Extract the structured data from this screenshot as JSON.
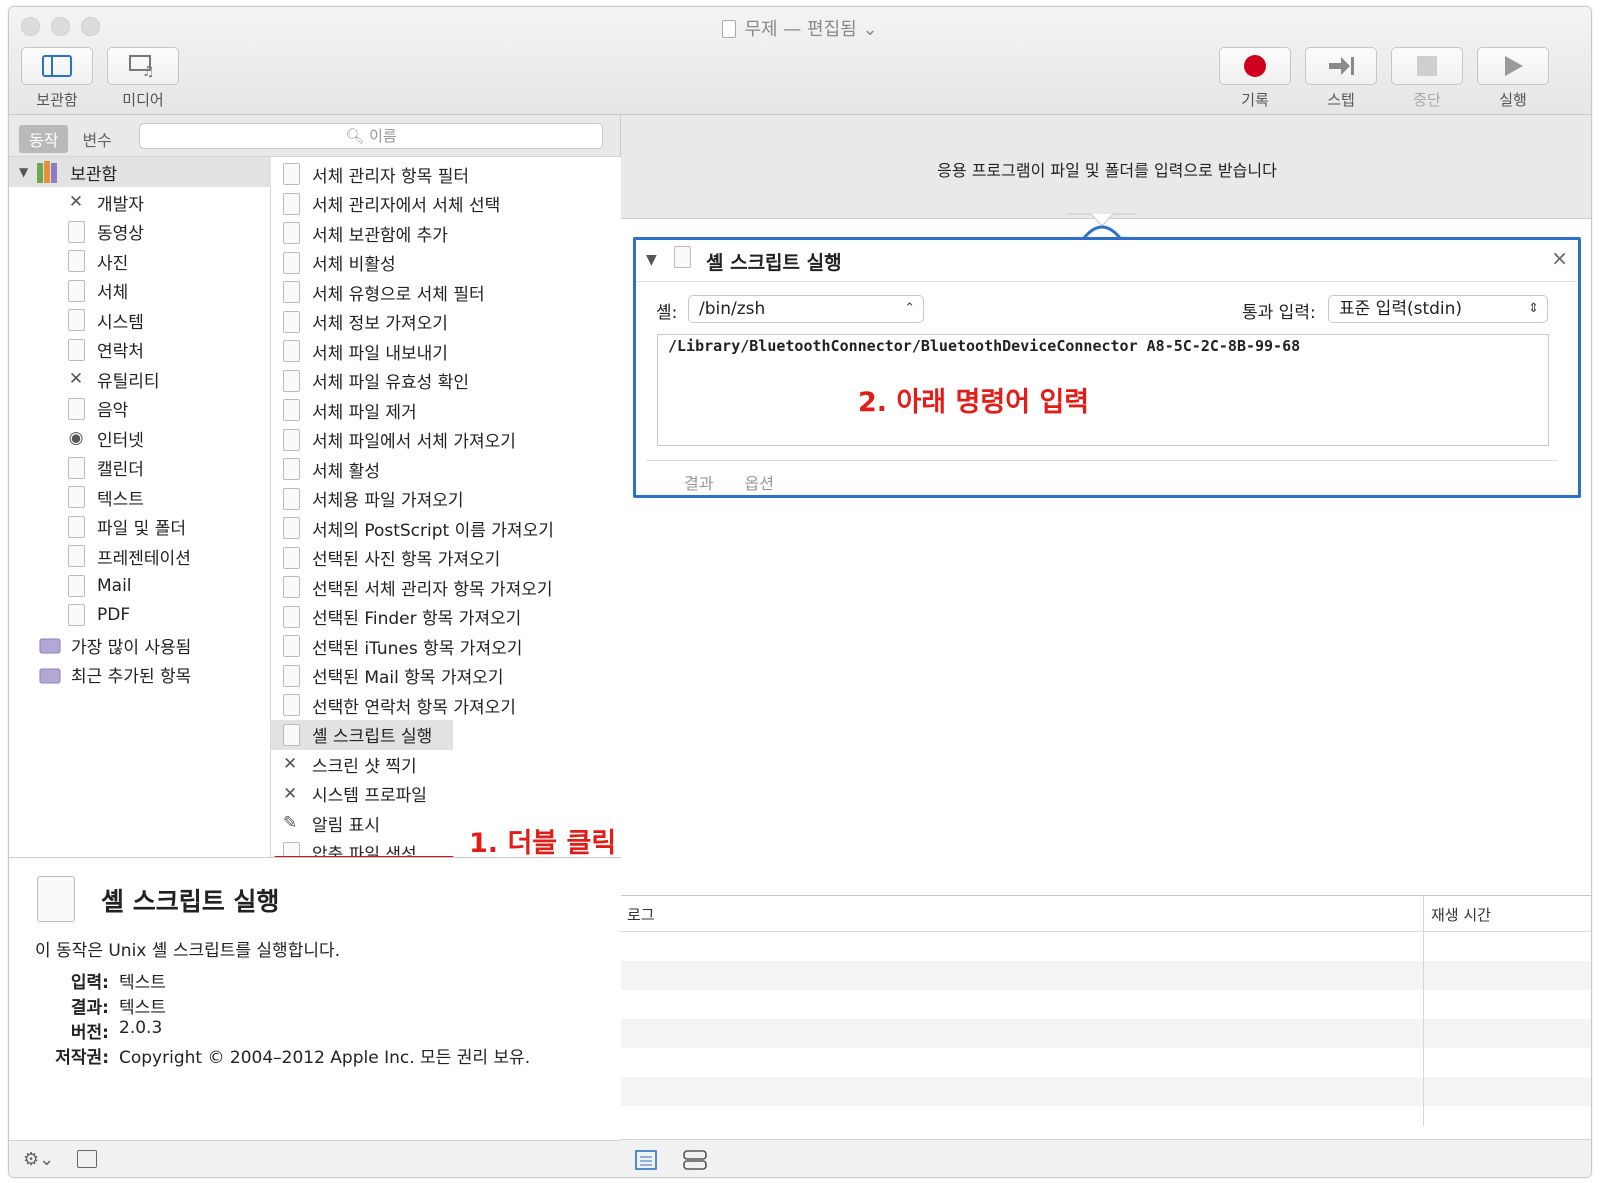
{
  "window": {
    "title": "무제 — 편집됨"
  },
  "toolbar": {
    "library": "보관함",
    "media": "미디어",
    "record": "기록",
    "step": "스텝",
    "stop": "중단",
    "run": "실행"
  },
  "left": {
    "tab_actions": "동작",
    "tab_variables": "변수",
    "search_placeholder": "이름",
    "library_root": "보관함",
    "library_items": [
      "개발자",
      "동영상",
      "사진",
      "서체",
      "시스템",
      "연락처",
      "유틸리티",
      "음악",
      "인터넷",
      "캘린더",
      "텍스트",
      "파일 및 폴더",
      "프레젠테이션",
      "Mail",
      "PDF"
    ],
    "smart": [
      "가장 많이 사용됨",
      "최근 추가된 항목"
    ],
    "actions": [
      "서체 관리자 항목 필터",
      "서체 관리자에서 서체 선택",
      "서체 보관함에 추가",
      "서체 비활성",
      "서체 유형으로 서체 필터",
      "서체 정보 가져오기",
      "서체 파일 내보내기",
      "서체 파일 유효성 확인",
      "서체 파일 제거",
      "서체 파일에서 서체 가져오기",
      "서체 활성",
      "서체용 파일 가져오기",
      "서체의 PostScript 이름 가져오기",
      "선택된 사진 항목 가져오기",
      "선택된 서체 관리자 항목 가져오기",
      "선택된 Finder 항목 가져오기",
      "선택된 iTunes 항목 가져오기",
      "선택된 Mail 항목 가져오기",
      "선택한 연락처 항목 가져오기",
      "셸 스크립트 실행",
      "스크린 샷 찍기",
      "시스템 프로파일",
      "알림 표시",
      "압축 파일 생성"
    ],
    "annotation_double_click": "1. 더블 클릭"
  },
  "description": {
    "title": "셸 스크립트 실행",
    "summary": "이 동작은 Unix 셸 스크립트를 실행합니다.",
    "input_label": "입력:",
    "input_value": "텍스트",
    "result_label": "결과:",
    "result_value": "텍스트",
    "version_label": "버전:",
    "version_value": "2.0.3",
    "copyright_label": "저작권:",
    "copyright_value": "Copyright © 2004–2012 Apple Inc.  모든 권리 보유."
  },
  "workflow": {
    "input_message": "응용 프로그램이 파일 및 폴더를 입력으로 받습니다",
    "action_title": "셸 스크립트 실행",
    "shell_label": "셸:",
    "shell_value": "/bin/zsh",
    "pass_input_label": "통과 입력:",
    "pass_input_value": "표준 입력(stdin)",
    "script": "/Library/BluetoothConnector/BluetoothDeviceConnector A8-5C-2C-8B-99-68",
    "annotation_enter": "2. 아래 명령어 입력",
    "tab_results": "결과",
    "tab_options": "옵션"
  },
  "log": {
    "col_log": "로그",
    "col_duration": "재생 시간"
  },
  "colors": {
    "record": "#d0021b",
    "accent": "#2d70c8",
    "annotation": "#e41b17"
  }
}
